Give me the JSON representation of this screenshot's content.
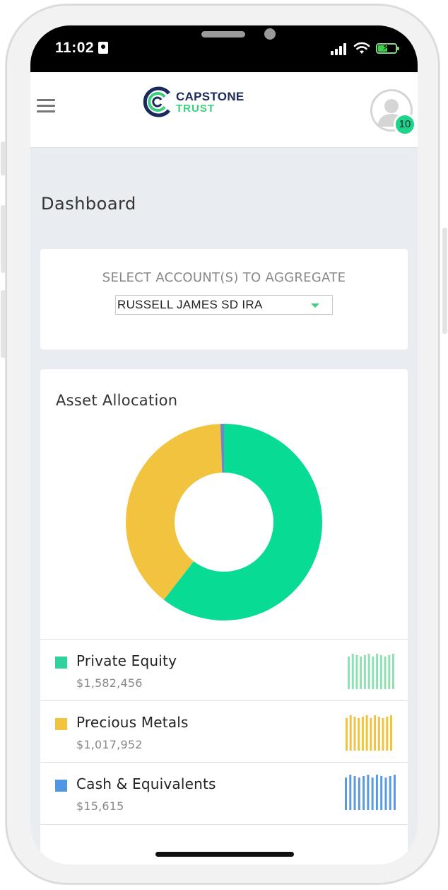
{
  "status_bar": {
    "time": "11:02",
    "icons": [
      "id-badge-icon",
      "cellular-signal-icon",
      "wifi-icon",
      "battery-charging-icon"
    ]
  },
  "header": {
    "menu_icon": "hamburger-menu-icon",
    "logo": {
      "line1": "CAPSTONE",
      "line2": "TRUST"
    },
    "avatar_icon": "user-avatar-icon",
    "notification_count": "10"
  },
  "page": {
    "title": "Dashboard"
  },
  "account_selector": {
    "label": "SELECT ACCOUNT(S) TO AGGREGATE",
    "selected": "RUSSELL JAMES SD IRA"
  },
  "asset_allocation": {
    "title": "Asset Allocation",
    "items": [
      {
        "name": "Private Equity",
        "value": "$1,582,456",
        "color": "#2fd39b"
      },
      {
        "name": "Precious Metals",
        "value": "$1,017,952",
        "color": "#f1c33f"
      },
      {
        "name": "Cash & Equivalents",
        "value": "$15,615",
        "color": "#4f97e3"
      }
    ]
  },
  "chart_data": {
    "type": "pie",
    "title": "Asset Allocation",
    "labels": [
      "Private Equity",
      "Precious Metals",
      "Cash & Equivalents"
    ],
    "values": [
      1582456,
      1017952,
      15615
    ],
    "colors": [
      "#08db93",
      "#f1c33f",
      "#6f86c9"
    ],
    "donut": true,
    "legend": "bottom"
  },
  "colors": {
    "accent_green": "#1fd38a",
    "brand_navy": "#1b2a5c"
  }
}
